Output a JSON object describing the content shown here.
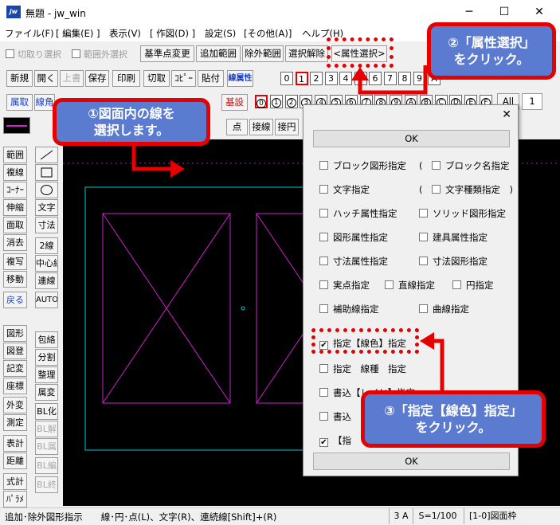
{
  "window": {
    "title": "無題 - jw_win",
    "icon_label": "jw",
    "minimize": "─",
    "maximize": "☐",
    "close": "✕"
  },
  "menu": [
    "ファイル(F)",
    "[ 編集(E) ]",
    "表示(V)",
    "[ 作図(D) ]",
    "設定(S)",
    "[その他(A)]",
    "ヘルプ(H)"
  ],
  "toolbar1": {
    "cut_select": "切取り選択",
    "range_external": "範囲外選択",
    "base_change": "基準点変更",
    "add_range": "追加範囲",
    "exclude_range": "除外範囲",
    "deselect": "選択解除",
    "attr_select": "<属性選択>"
  },
  "toolbar2": {
    "buttons": [
      "新規",
      "開く",
      "上書",
      "保存",
      "印刷",
      "切取",
      "ｺﾋﾟｰ",
      "貼付",
      "線属性"
    ],
    "layers": [
      "0",
      "1",
      "2",
      "3",
      "4",
      "5",
      "6",
      "7",
      "8",
      "9",
      "A"
    ]
  },
  "toolbar3": {
    "buttons": [
      "属取",
      "線角"
    ],
    "kisetsu": "基設",
    "groups": [
      "0",
      "1",
      "2",
      "3",
      "4",
      "5",
      "6",
      "7",
      "8",
      "9",
      "A",
      "B",
      "C",
      "D",
      "E",
      "F"
    ],
    "all": "All",
    "one": "1"
  },
  "toolbar4": {
    "point": "点",
    "tangent_line": "接線",
    "tangent_circle": "接円"
  },
  "left_tools": {
    "col1": [
      "範囲",
      "複線",
      "ｺｰﾅｰ",
      "伸縮",
      "面取",
      "消去",
      "複写",
      "移動",
      "戻る",
      "図形",
      "図登",
      "記変",
      "座標",
      "外変",
      "測定",
      "表計",
      "距離",
      "式計",
      "ﾊﾟﾗﾒ"
    ],
    "col2": [
      "文字",
      "寸法",
      "2線",
      "中心線",
      "連線",
      "AUTO",
      "包絡",
      "分割",
      "整理",
      "属変",
      "BL化",
      "BL解",
      "BL属",
      "BL編",
      "BL終"
    ]
  },
  "dialog": {
    "close": "✕",
    "ok_top": "OK",
    "ok_bottom": "OK",
    "items": {
      "block_fig": "ブロック図形指定",
      "block_name": "ブロック名指定",
      "paren_open1": "(",
      "paren_close1": ")",
      "text": "文字指定",
      "text_type": "文字種類指定",
      "paren_open2": "(",
      "paren_close2": ")",
      "hatch": "ハッチ属性指定",
      "solid": "ソリッド図形指定",
      "figure_attr": "図形属性指定",
      "fixture_attr": "建具属性指定",
      "dim_attr": "寸法属性指定",
      "dim_fig": "寸法図形指定",
      "real_point": "実点指定",
      "line": "直線指定",
      "circle": "円指定",
      "aux_line": "補助線指定",
      "curve": "曲線指定",
      "line_color": "指定【線色】指定",
      "line_type": "指定　線種　指定",
      "write_layer": "書込【レイヤ】指定",
      "write_other": "書込",
      "last_label": "【指"
    }
  },
  "callouts": {
    "c1": "①図面内の線を\n選択します。",
    "c2": "②「属性選択」\nをクリック。",
    "c3": "③「指定【線色】指定」\nをクリック。"
  },
  "status": {
    "message": "追加･除外図形指示　　線･円･点(L)、文字(R)、連続線[Shift]+(R)",
    "size": "3 A",
    "scale": "S=1/100",
    "layer": "[1-0]図面枠"
  },
  "colors": {
    "canvas": "#000000",
    "drawing": "#d020d0",
    "frame": "#00c8d0",
    "accent": "#e60000",
    "callout": "#5b7bd0"
  }
}
